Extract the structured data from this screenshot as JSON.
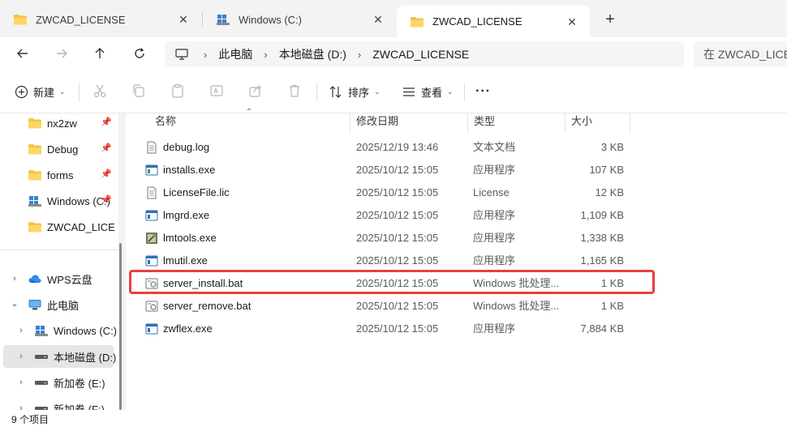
{
  "tabs": [
    {
      "label": "ZWCAD_LICENSE",
      "icon": "folder-icon"
    },
    {
      "label": "Windows (C:)",
      "icon": "drive-icon"
    },
    {
      "label": "ZWCAD_LICENSE",
      "icon": "folder-icon"
    }
  ],
  "active_tab": 2,
  "breadcrumb": [
    "此电脑",
    "本地磁盘 (D:)",
    "ZWCAD_LICENSE"
  ],
  "search": {
    "placeholder": "在 ZWCAD_LICENSE 中搜索"
  },
  "commandbar": {
    "new_label": "新建",
    "sort_label": "排序",
    "view_label": "查看",
    "more_label": "···"
  },
  "sidebar": {
    "quick_access": [
      {
        "label": "nx2zw",
        "icon": "folder-icon",
        "pinned": true
      },
      {
        "label": "Debug",
        "icon": "folder-icon",
        "pinned": true
      },
      {
        "label": "forms",
        "icon": "folder-icon",
        "pinned": true
      },
      {
        "label": "Windows (C:)",
        "icon": "drive-icon",
        "pinned": true
      },
      {
        "label": "ZWCAD_LICENSE",
        "icon": "folder-icon",
        "pinned": false
      }
    ],
    "tree": [
      {
        "label": "WPS云盘",
        "icon": "cloud-icon",
        "expander": "›"
      },
      {
        "label": "此电脑",
        "icon": "pc-icon",
        "expander": "⌄"
      },
      {
        "label": "Windows (C:)",
        "icon": "drive-icon",
        "expander": "›"
      },
      {
        "label": "本地磁盘 (D:)",
        "icon": "hdd-icon",
        "expander": "›",
        "selected": true
      },
      {
        "label": "新加卷 (E:)",
        "icon": "hdd-icon",
        "expander": "›"
      },
      {
        "label": "新加卷 (F:)",
        "icon": "hdd-icon",
        "expander": "›"
      }
    ]
  },
  "columns": {
    "name": "名称",
    "date": "修改日期",
    "type": "类型",
    "size": "大小"
  },
  "files": [
    {
      "name": "debug.log",
      "date": "2025/12/19 13:46",
      "type": "文本文档",
      "size": "3 KB",
      "icon": "text-file-icon"
    },
    {
      "name": "installs.exe",
      "date": "2025/10/12 15:05",
      "type": "应用程序",
      "size": "107 KB",
      "icon": "exe-icon"
    },
    {
      "name": "LicenseFile.lic",
      "date": "2025/10/12 15:05",
      "type": "License",
      "size": "12 KB",
      "icon": "text-file-icon"
    },
    {
      "name": "lmgrd.exe",
      "date": "2025/10/12 15:05",
      "type": "应用程序",
      "size": "1,109 KB",
      "icon": "exe-icon"
    },
    {
      "name": "lmtools.exe",
      "date": "2025/10/12 15:05",
      "type": "应用程序",
      "size": "1,338 KB",
      "icon": "lmtools-icon"
    },
    {
      "name": "lmutil.exe",
      "date": "2025/10/12 15:05",
      "type": "应用程序",
      "size": "1,165 KB",
      "icon": "exe-icon"
    },
    {
      "name": "server_install.bat",
      "date": "2025/10/12 15:05",
      "type": "Windows 批处理...",
      "size": "1 KB",
      "icon": "bat-icon",
      "highlighted": true
    },
    {
      "name": "server_remove.bat",
      "date": "2025/10/12 15:05",
      "type": "Windows 批处理...",
      "size": "1 KB",
      "icon": "bat-icon"
    },
    {
      "name": "zwflex.exe",
      "date": "2025/10/12 15:05",
      "type": "应用程序",
      "size": "7,884 KB",
      "icon": "exe-icon"
    }
  ],
  "status": {
    "item_count": "9 个项目"
  },
  "colors": {
    "highlight_border": "#e8403c",
    "folder": "#f4c24d",
    "accent": "#0067c0"
  }
}
